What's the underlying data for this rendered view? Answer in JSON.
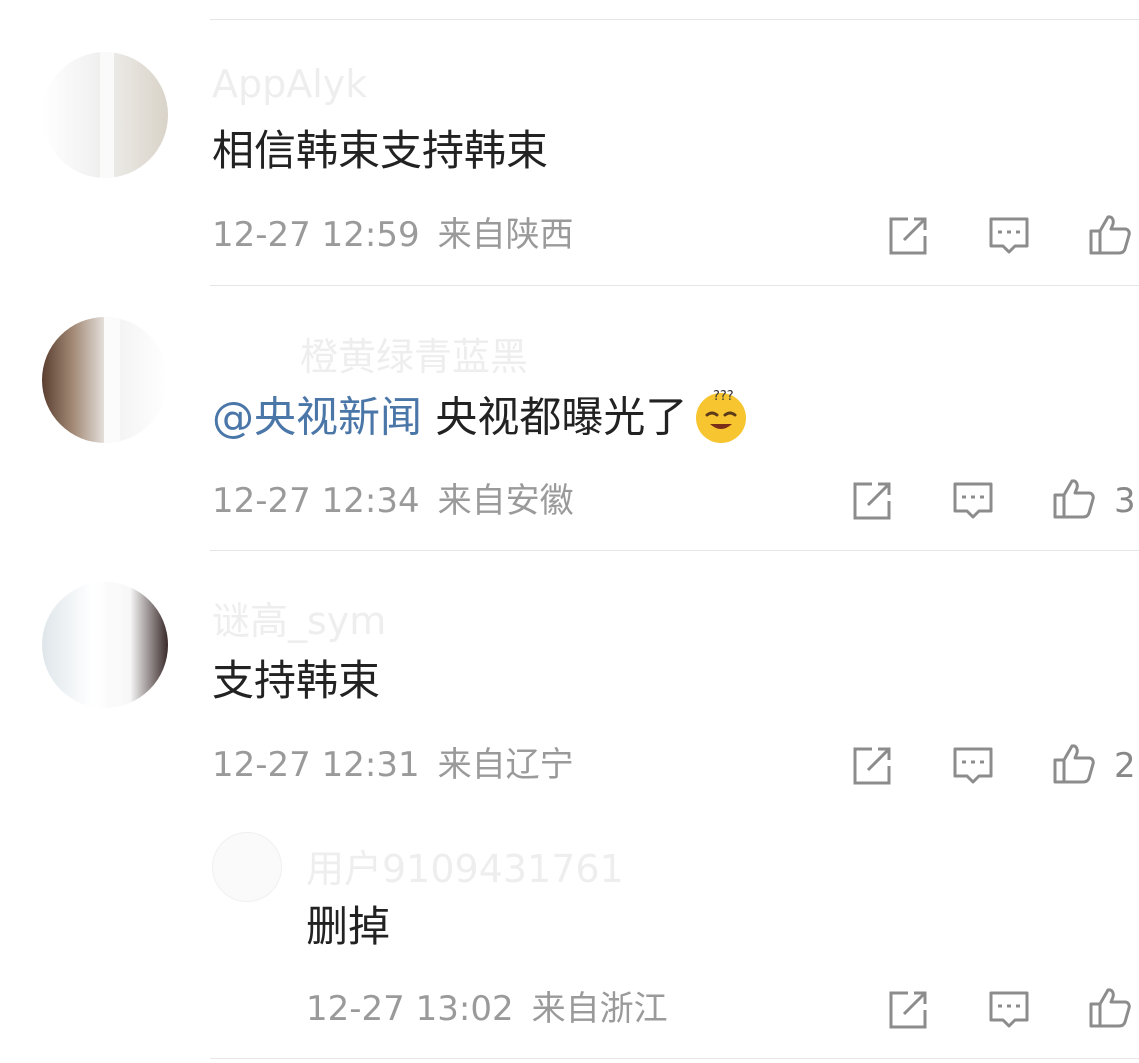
{
  "comments": [
    {
      "username": "AppAlyk",
      "content": "相信韩束支持韩束",
      "time": "12-27 12:59",
      "location": "来自陕西",
      "likes": ""
    },
    {
      "username": "橙黄绿青蓝黑",
      "mention": "@央视新闻",
      "content": "央视都曝光了",
      "emoji": "sleepy-face-emoji",
      "time": "12-27 12:34",
      "location": "来自安徽",
      "likes": "3"
    },
    {
      "username": "谜高_sym",
      "content": "支持韩束",
      "time": "12-27 12:31",
      "location": "来自辽宁",
      "likes": "2",
      "reply": {
        "username": "用户9109431761",
        "content": "删掉",
        "time": "12-27 13:02",
        "location": "来自浙江",
        "likes": ""
      }
    }
  ],
  "icons": {
    "share": "share-icon",
    "comment": "comment-icon",
    "like": "thumbs-up-icon"
  },
  "colors": {
    "mention": "#4a76a8",
    "text": "#222222",
    "meta": "#9a9a9a",
    "icon": "#888888",
    "divider": "#e6e6e6"
  }
}
